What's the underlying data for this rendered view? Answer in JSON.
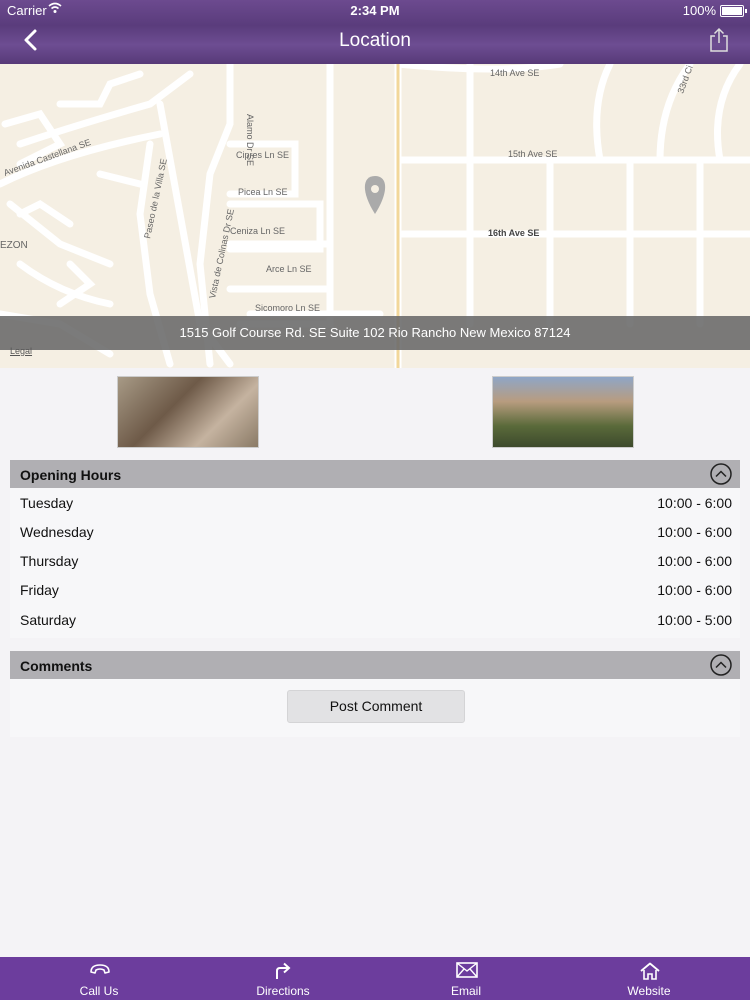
{
  "status_bar": {
    "carrier": "Carrier",
    "time": "2:34 PM",
    "battery": "100%"
  },
  "nav": {
    "title": "Location",
    "back_icon": "chevron-left-icon",
    "share_icon": "share-icon"
  },
  "map": {
    "address": "1515 Golf Course Rd. SE Suite 102 Rio Rancho New Mexico 87124",
    "legal": "Legal",
    "street_labels": [
      "14th Ave SE",
      "15th Ave SE",
      "16th Ave SE",
      "Cipres Ln SE",
      "Picea Ln SE",
      "Ceniza Ln SE",
      "Arce Ln SE",
      "Sicomoro Ln SE",
      "Avenida Castellana SE",
      "Paseo de la Villa SE",
      "Vista de Colinas Dr SE",
      "Alamo Dr SE",
      "EZON",
      "33rd Ci"
    ]
  },
  "opening_hours": {
    "title": "Opening Hours",
    "rows": [
      {
        "day": "Tuesday",
        "hours": "10:00 - 6:00"
      },
      {
        "day": "Wednesday",
        "hours": "10:00 - 6:00"
      },
      {
        "day": "Thursday",
        "hours": "10:00 - 6:00"
      },
      {
        "day": "Friday",
        "hours": "10:00 - 6:00"
      },
      {
        "day": "Saturday",
        "hours": "10:00 - 5:00"
      }
    ]
  },
  "comments": {
    "title": "Comments",
    "post_label": "Post Comment"
  },
  "tabs": [
    {
      "label": "Call Us",
      "icon": "phone-icon"
    },
    {
      "label": "Directions",
      "icon": "directions-arrow-icon"
    },
    {
      "label": "Email",
      "icon": "envelope-icon"
    },
    {
      "label": "Website",
      "icon": "home-icon"
    }
  ],
  "colors": {
    "header": "#5e3f80",
    "tabbar": "#6c3d9d",
    "section_header": "#b0afb3"
  }
}
